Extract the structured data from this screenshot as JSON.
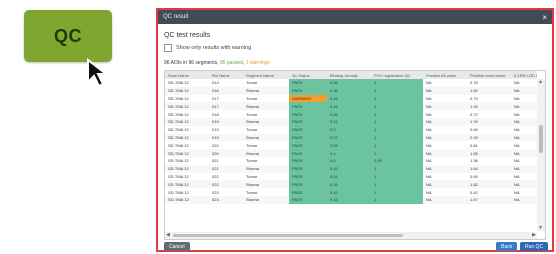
{
  "tile": {
    "label": "QC"
  },
  "dialog": {
    "title": "QC result",
    "close": "×",
    "section_title": "QC test results",
    "checkbox_label": "Show only results with warning",
    "summary": {
      "main": "96 AOIs in 96 segments, ",
      "passed": "95 passed",
      "sep": ", ",
      "warnings": "1 warnings"
    },
    "columns": [
      "Scan Name",
      "Roi Name",
      "Segment Name",
      "Qc Status",
      "Binding Density",
      "POV registration QC",
      "Positive 83 value",
      "Positive norm factor",
      "0-1RN LOD QC"
    ],
    "rows": [
      [
        "SD-TMA 12",
        "014",
        "Tumor",
        "PASS",
        "0.56",
        "1",
        "NA",
        "0.78",
        "NA"
      ],
      [
        "SD-TMA 12",
        "016",
        "Stroma",
        "PASS",
        "0.38",
        "1",
        "NA",
        "1.82",
        "NA"
      ],
      [
        "SD-TMA 12",
        "017",
        "Tumor",
        "WARNING",
        "0.42",
        "1",
        "NA",
        "0.73",
        "NA"
      ],
      [
        "SD-TMA 12",
        "017",
        "Stroma",
        "PASS",
        "0.43",
        "1",
        "NA",
        "1.49",
        "NA"
      ],
      [
        "SD-TMA 12",
        "018",
        "Tumor",
        "PASS",
        "0.66",
        "1",
        "NA",
        "0.72",
        "NA"
      ],
      [
        "SD-TMA 12",
        "018",
        "Stroma",
        "PASS",
        "0.41",
        "1",
        "NA",
        "1.76",
        "NA"
      ],
      [
        "SD-TMA 12",
        "019",
        "Tumor",
        "PASS",
        "0.5",
        "1",
        "NA",
        "0.69",
        "NA"
      ],
      [
        "SD-TMA 12",
        "019",
        "Stroma",
        "PASS",
        "0.37",
        "1",
        "NA",
        "2.03",
        "NA"
      ],
      [
        "SD-TMA 12",
        "020",
        "Tumor",
        "PASS",
        "0.59",
        "1",
        "NA",
        "0.61",
        "NA"
      ],
      [
        "SD-TMA 12",
        "020",
        "Stroma",
        "PASS",
        "0.4",
        "1",
        "NA",
        "1.65",
        "NA"
      ],
      [
        "SD-TMA 12",
        "021",
        "Tumor",
        "PASS",
        "0.5",
        "2.99",
        "NA",
        "1.36",
        "NA"
      ],
      [
        "SD-TMA 12",
        "021",
        "Stroma",
        "PASS",
        "0.42",
        "1",
        "NA",
        "1.64",
        "NA"
      ],
      [
        "SD-TMA 12",
        "022",
        "Tumor",
        "PASS",
        "0.51",
        "1",
        "NA",
        "0.65",
        "NA"
      ],
      [
        "SD-TMA 12",
        "022",
        "Stroma",
        "PASS",
        "0.39",
        "1",
        "NA",
        "1.82",
        "NA"
      ],
      [
        "SD-TMA 12",
        "023",
        "Tumor",
        "PASS",
        "0.42",
        "1",
        "NA",
        "0.42",
        "NA"
      ],
      [
        "SD-TMA 12",
        "023",
        "Stroma",
        "PASS",
        "0.43",
        "1",
        "NA",
        "1.67",
        "NA"
      ]
    ],
    "scroll": {
      "up": "▲",
      "down": "▼",
      "left": "◀",
      "right": "▶"
    },
    "buttons": {
      "cancel": "Cancel",
      "back": "Back",
      "run_qc": "Run QC"
    }
  },
  "colors": {
    "tile": "#7fa62f",
    "dialog_border": "#e23b3b",
    "pass": "#6cc3a0",
    "warning": "#f0a030",
    "primary": "#2e68b4"
  }
}
